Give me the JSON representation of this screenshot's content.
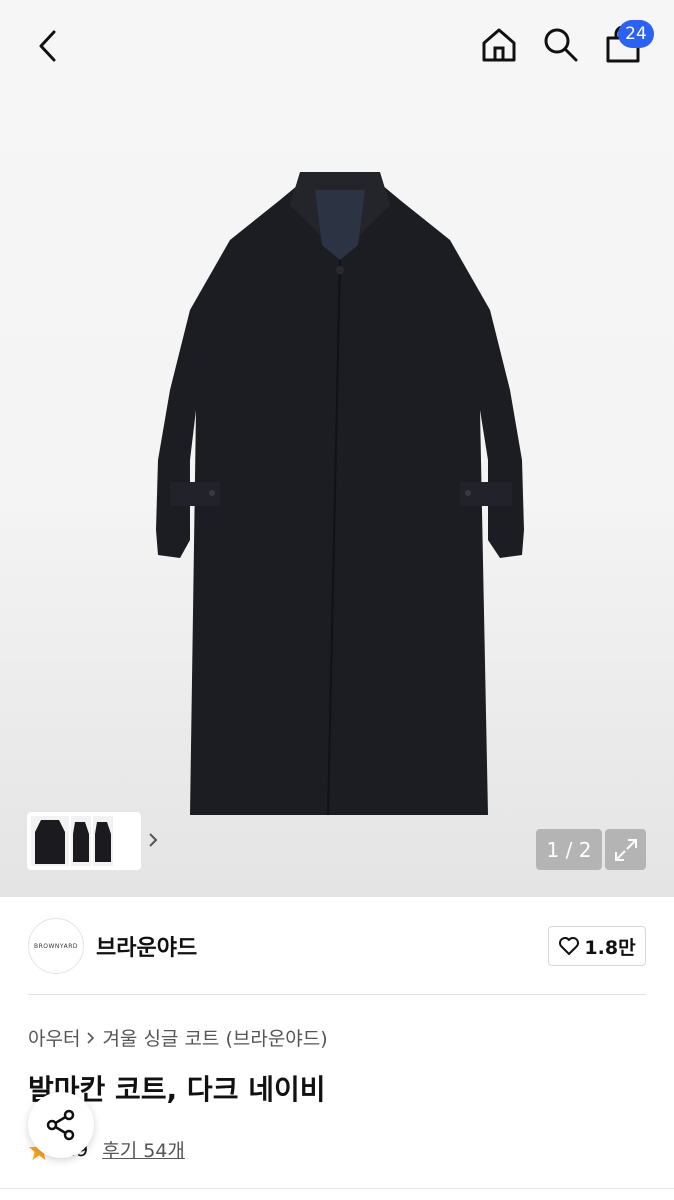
{
  "header": {
    "back_icon": "chevron-left-icon",
    "home_icon": "home-icon",
    "search_icon": "search-icon",
    "cart_icon": "shopping-bag-icon",
    "cart_count": "24",
    "badge_color": "#2b62f3"
  },
  "gallery": {
    "counter": "1 / 2",
    "expand_icon": "expand-icon",
    "thumb_more_icon": "chevron-right-icon"
  },
  "brand": {
    "logo_text": "BROWNYARD",
    "name": "브라운야드",
    "like_count": "1.8만"
  },
  "product": {
    "breadcrumb": [
      "아우터",
      "겨울 싱글 코트 (브라운야드)"
    ],
    "title": "발마칸 코트, 다크 네이비",
    "rating": "4.9",
    "reviews": "후기 54개",
    "star_color": "#f5a623"
  }
}
